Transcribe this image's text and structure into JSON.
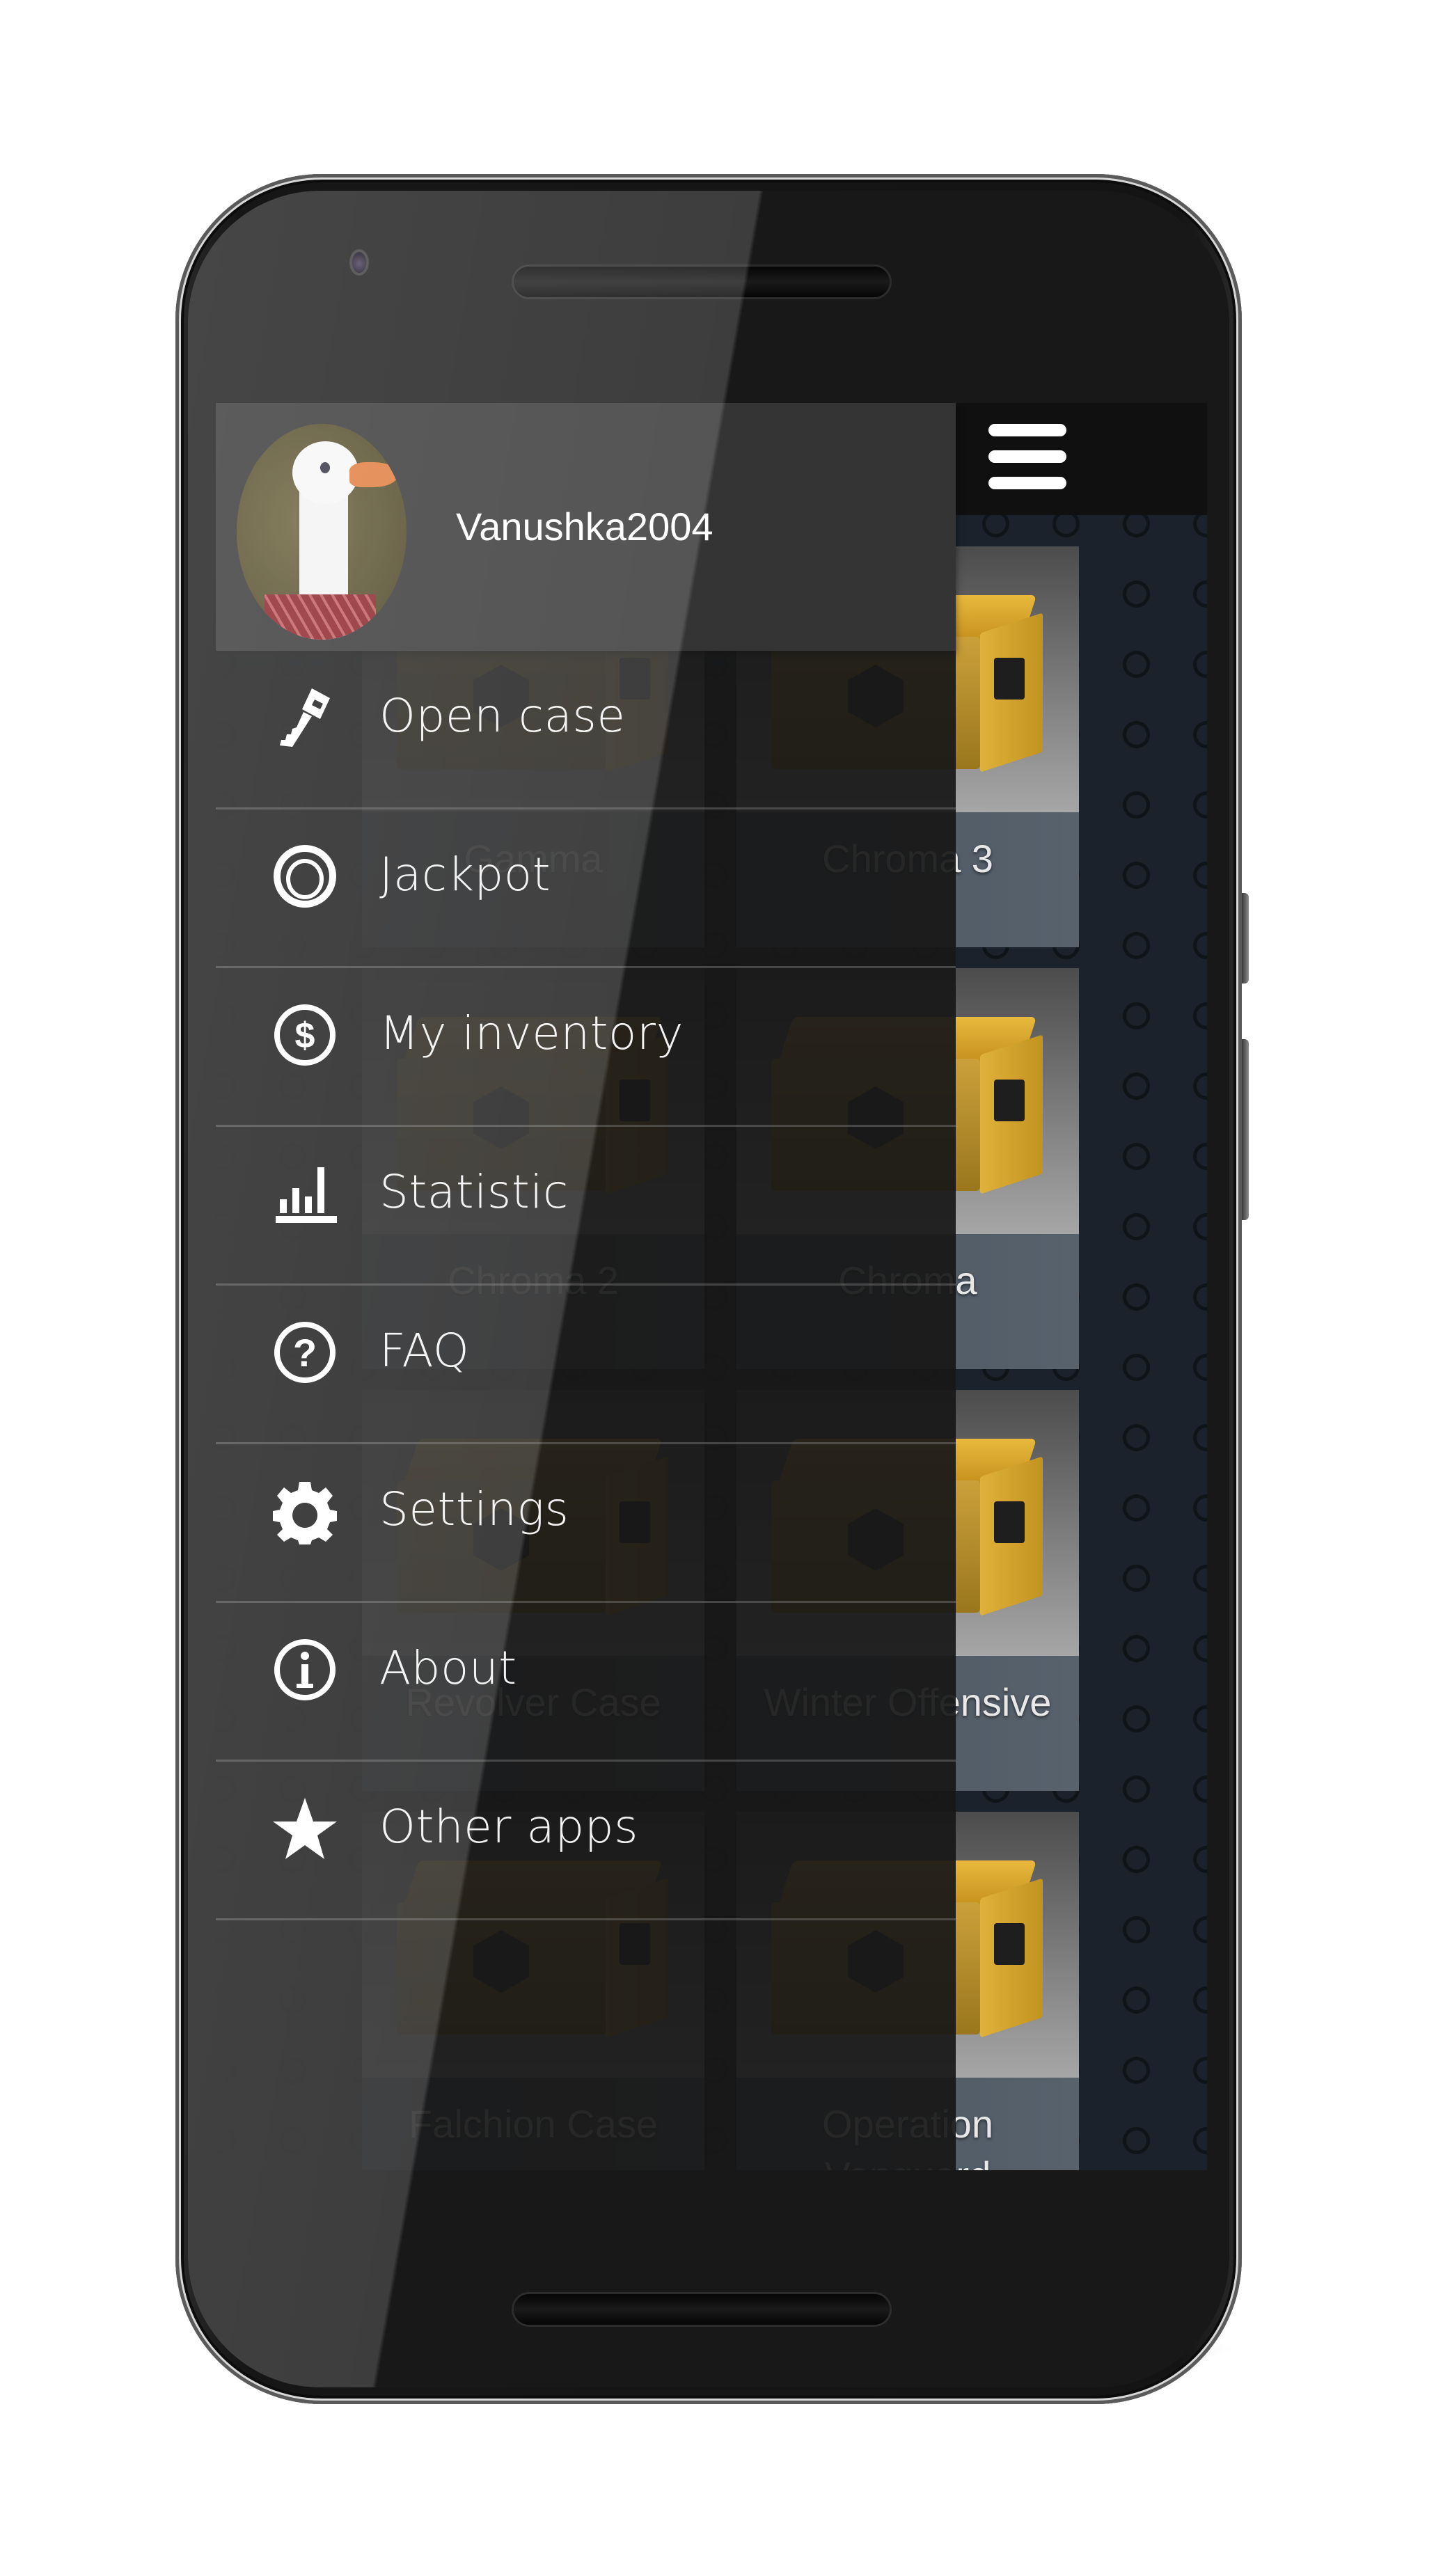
{
  "device": {
    "type": "phone-mockup"
  },
  "toolbar": {
    "menu_icon": "hamburger-menu-icon"
  },
  "drawer": {
    "header": {
      "username": "Vanushka2004",
      "avatar": "goose-avatar"
    },
    "items": [
      {
        "label": "Open case",
        "icon": "key-icon"
      },
      {
        "label": "Jackpot",
        "icon": "ring-icon"
      },
      {
        "label": "My inventory",
        "icon": "dollar-circle-icon"
      },
      {
        "label": "Statistic",
        "icon": "bar-chart-icon"
      },
      {
        "label": "FAQ",
        "icon": "question-circle-icon"
      },
      {
        "label": "Settings",
        "icon": "gear-icon"
      },
      {
        "label": "About",
        "icon": "info-circle-icon"
      },
      {
        "label": "Other apps",
        "icon": "star-icon"
      }
    ]
  },
  "cases": [
    {
      "name": "Gamma"
    },
    {
      "name": "Chroma 3"
    },
    {
      "name": "Chroma 2"
    },
    {
      "name": "Chroma"
    },
    {
      "name": "Revolver Case"
    },
    {
      "name": "Winter Offensive"
    },
    {
      "name": "Falchion Case"
    },
    {
      "name": "Operation Vanguard"
    }
  ],
  "colors": {
    "toolbar": "#101010",
    "background": "#1b222b",
    "drawer_header": "#343434",
    "drawer_body": "#181818",
    "case_label": "#4a5560",
    "crate_yellow": "#e0b23a"
  }
}
